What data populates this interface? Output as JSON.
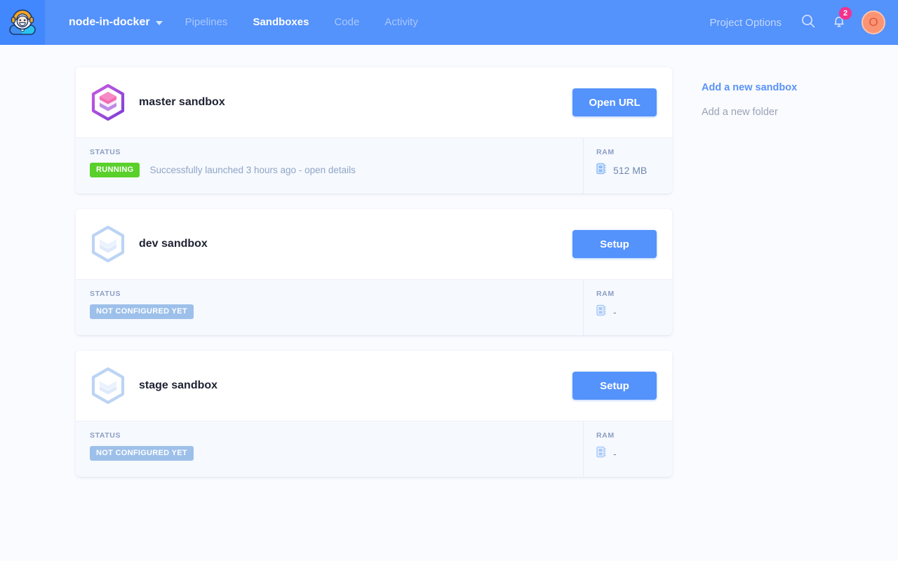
{
  "header": {
    "logo_icon": "astronaut-logo-icon",
    "project_name": "node-in-docker",
    "nav": [
      {
        "label": "Pipelines",
        "active": false
      },
      {
        "label": "Sandboxes",
        "active": true
      },
      {
        "label": "Code",
        "active": false
      },
      {
        "label": "Activity",
        "active": false
      }
    ],
    "project_options": "Project Options",
    "search_icon": "search-icon",
    "bell_icon": "notification-bell-icon",
    "notification_count": "2",
    "avatar_initial": "O",
    "colors": {
      "bar": "#5492fc",
      "logo_block": "#4187fd",
      "badge": "#f2328c",
      "avatar": "#fa9472"
    }
  },
  "sandboxes": [
    {
      "name": "master sandbox",
      "icon": "sandbox-hexagon-icon",
      "icon_state": "active",
      "action_label": "Open URL",
      "status_label": "STATUS",
      "status_pill": "RUNNING",
      "status_pill_kind": "running",
      "status_message": "Successfully launched 3 hours ago - open details",
      "ram_label": "RAM",
      "ram_icon": "memory-chip-icon",
      "ram_value": "512 MB"
    },
    {
      "name": "dev sandbox",
      "icon": "sandbox-hexagon-icon",
      "icon_state": "inactive",
      "action_label": "Setup",
      "status_label": "STATUS",
      "status_pill": "NOT CONFIGURED YET",
      "status_pill_kind": "notconf",
      "status_message": "",
      "ram_label": "RAM",
      "ram_icon": "memory-chip-icon",
      "ram_value": "-"
    },
    {
      "name": "stage sandbox",
      "icon": "sandbox-hexagon-icon",
      "icon_state": "inactive",
      "action_label": "Setup",
      "status_label": "STATUS",
      "status_pill": "NOT CONFIGURED YET",
      "status_pill_kind": "notconf",
      "status_message": "",
      "ram_label": "RAM",
      "ram_icon": "memory-chip-icon",
      "ram_value": "-"
    }
  ],
  "sidebar": {
    "links": [
      {
        "label": "Add a new sandbox",
        "style": "primary"
      },
      {
        "label": "Add a new folder",
        "style": "muted"
      }
    ]
  },
  "status_colors": {
    "running": "#5ad02b",
    "not_configured": "#9dc0ea"
  }
}
